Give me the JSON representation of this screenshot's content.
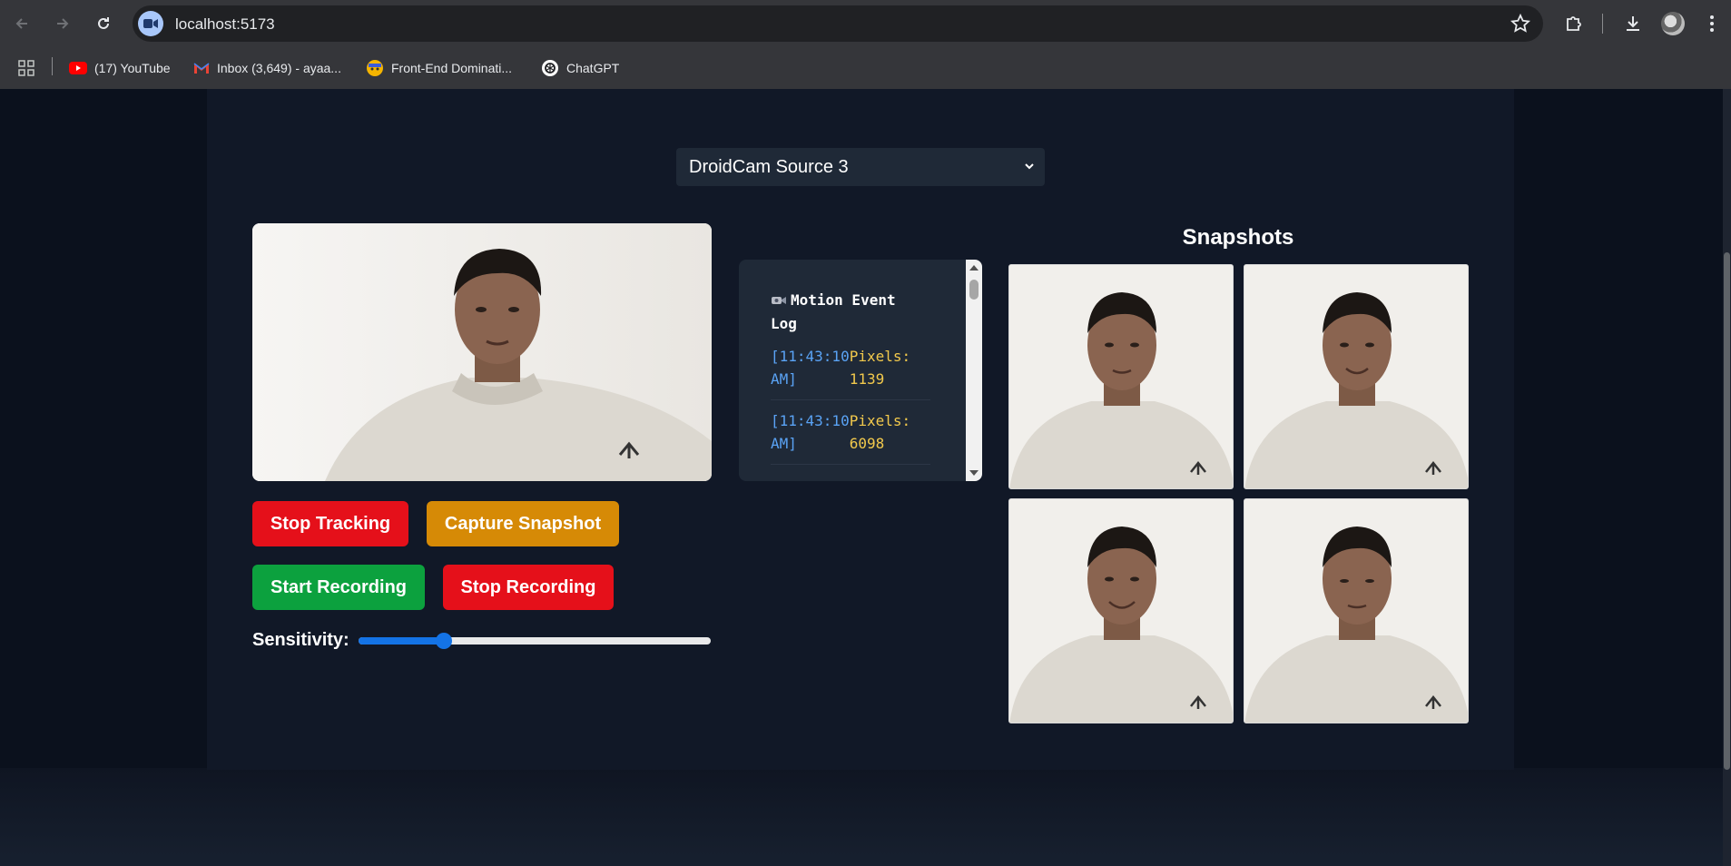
{
  "browser": {
    "url": "localhost:5173",
    "bookmarks": [
      {
        "label": "(17) YouTube",
        "icon": "youtube-icon"
      },
      {
        "label": "Inbox (3,649) - ayaa...",
        "icon": "gmail-icon"
      },
      {
        "label": "Front-End Dominati...",
        "icon": "bookmark-avatar-icon"
      },
      {
        "label": "ChatGPT",
        "icon": "chatgpt-icon"
      }
    ]
  },
  "camera": {
    "selected_source": "DroidCam Source 3"
  },
  "controls": {
    "stop_tracking": "Stop Tracking",
    "capture_snapshot": "Capture Snapshot",
    "start_recording": "Start Recording",
    "stop_recording": "Stop Recording",
    "sensitivity_label": "Sensitivity:",
    "sensitivity_fraction": 0.23
  },
  "log": {
    "icon": "camera-icon",
    "title": "Motion Event Log",
    "entries": [
      {
        "time": "[11:43:10 AM]",
        "pixels": "Pixels: 1139"
      },
      {
        "time": "[11:43:10 AM]",
        "pixels": "Pixels: 6098"
      }
    ]
  },
  "snapshots": {
    "title": "Snapshots",
    "count": 4
  },
  "colors": {
    "page_bg": "#0b111d",
    "panel_bg": "#111827",
    "card_bg": "#1f2937",
    "stop_red": "#e5101a",
    "capture_amber": "#d68a06",
    "record_green": "#0ca13e",
    "slider_blue": "#1473e6",
    "log_time_blue": "#5aa3f5",
    "log_pixels_yellow": "#f2c94c"
  }
}
